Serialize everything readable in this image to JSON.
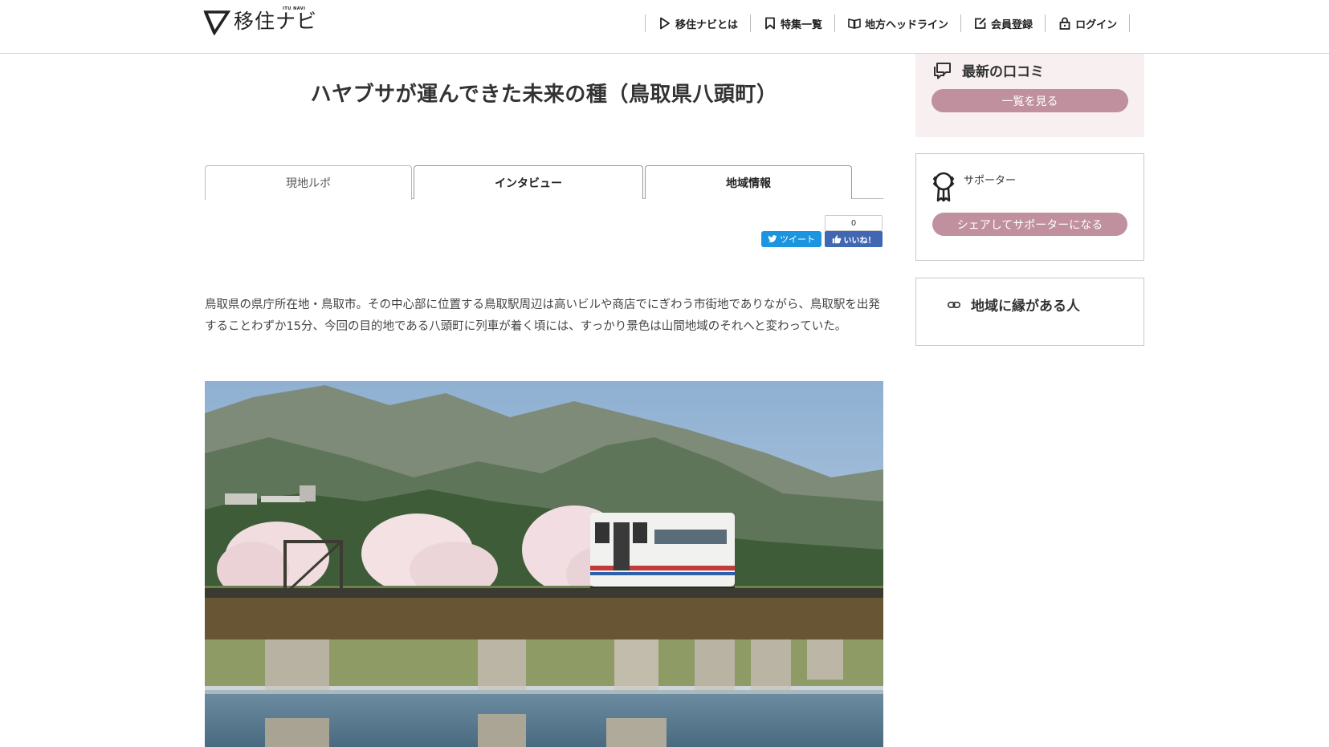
{
  "header": {
    "logo_text": "移住ナビ",
    "logo_sub": "ITU NAVI",
    "nav": [
      {
        "label": "移住ナビとは",
        "icon": "play-triangle-icon"
      },
      {
        "label": "特集一覧",
        "icon": "bookmark-icon"
      },
      {
        "label": "地方ヘッドライン",
        "icon": "book-icon"
      },
      {
        "label": "会員登録",
        "icon": "edit-icon"
      },
      {
        "label": "ログイン",
        "icon": "lock-icon"
      }
    ]
  },
  "article": {
    "title": "ハヤブサが運んできた未来の種（鳥取県八頭町）",
    "tabs": [
      {
        "label": "現地ルポ",
        "active": true
      },
      {
        "label": "インタビュー",
        "active": false
      },
      {
        "label": "地域情報",
        "active": false
      }
    ],
    "share": {
      "tweet_label": "ツイート",
      "like_count": "0",
      "like_label": "いいね！"
    },
    "lead": "鳥取県の県庁所在地・鳥取市。その中心部に位置する鳥取駅周辺は高いビルや商店でにぎわう市街地でありながら、鳥取駅を出発することわずか15分、今回の目的地である八頭町に列車が着く頃には、すっかり景色は山間地域のそれへと変わっていた。"
  },
  "sidebar": {
    "reviews": {
      "title": "最新の口コミ",
      "button": "一覧を見る"
    },
    "supporter": {
      "label": "サポーター",
      "button": "シェアしてサポーターになる"
    },
    "related": {
      "title": "地域に縁がある人"
    }
  },
  "colors": {
    "pill": "#c0909e",
    "pill_bg_box": "#f7eff0",
    "tweet": "#1b95e0",
    "facebook": "#4267b2"
  }
}
